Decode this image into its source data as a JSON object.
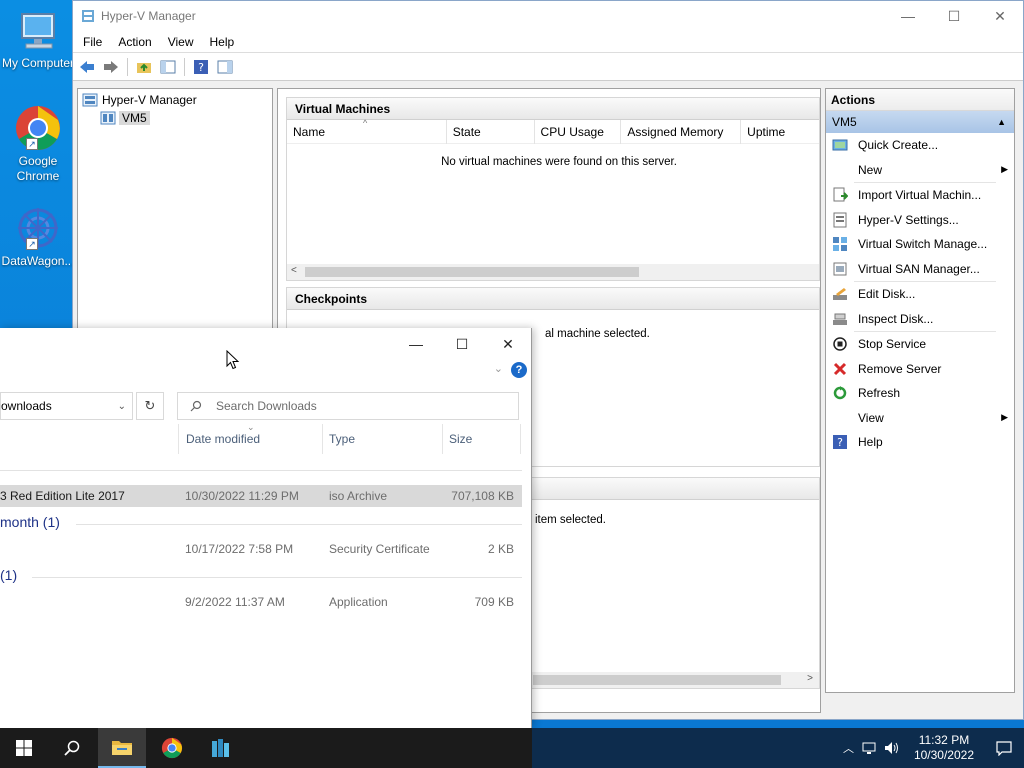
{
  "desktop": {
    "icons": [
      {
        "label": "My Computer",
        "icon": "monitor-icon"
      },
      {
        "label": "Google Chrome",
        "icon": "chrome-icon"
      },
      {
        "label": "DataWagon...",
        "icon": "datawagon-icon"
      }
    ]
  },
  "hyperv": {
    "title": "Hyper-V Manager",
    "menu": [
      "File",
      "Action",
      "View",
      "Help"
    ],
    "tree": {
      "root": "Hyper-V Manager",
      "child": "VM5"
    },
    "vm_pane": {
      "title": "Virtual Machines",
      "columns": [
        "Name",
        "State",
        "CPU Usage",
        "Assigned Memory",
        "Uptime"
      ],
      "empty": "No virtual machines were found on this server."
    },
    "checkpoints": {
      "title": "Checkpoints",
      "empty": "al machine selected."
    },
    "details": {
      "empty": "item selected."
    },
    "actions": {
      "title": "Actions",
      "section": "VM5",
      "items": [
        {
          "label": "Quick Create...",
          "icon": "quick-create-icon",
          "submenu": false
        },
        {
          "label": "New",
          "icon": "",
          "submenu": true
        },
        {
          "label": "Import Virtual Machin...",
          "icon": "import-icon",
          "submenu": false
        },
        {
          "label": "Hyper-V Settings...",
          "icon": "settings-icon",
          "submenu": false
        },
        {
          "label": "Virtual Switch Manage...",
          "icon": "switch-icon",
          "submenu": false
        },
        {
          "label": "Virtual SAN Manager...",
          "icon": "san-icon",
          "submenu": false
        },
        {
          "label": "Edit Disk...",
          "icon": "edit-disk-icon",
          "submenu": false
        },
        {
          "label": "Inspect Disk...",
          "icon": "inspect-disk-icon",
          "submenu": false
        },
        {
          "label": "Stop Service",
          "icon": "stop-icon",
          "submenu": false
        },
        {
          "label": "Remove Server",
          "icon": "remove-icon",
          "submenu": false
        },
        {
          "label": "Refresh",
          "icon": "refresh-icon",
          "submenu": false
        },
        {
          "label": "View",
          "icon": "",
          "submenu": true
        },
        {
          "label": "Help",
          "icon": "help-icon",
          "submenu": false
        }
      ]
    }
  },
  "explorer": {
    "address": "ownloads",
    "search_placeholder": "Search Downloads",
    "columns": [
      "Date modified",
      "Type",
      "Size"
    ],
    "rows": [
      {
        "name": "3 Red Edition Lite 2017",
        "date": "10/30/2022 11:29 PM",
        "type": "iso Archive",
        "size": "707,108 KB"
      },
      {
        "name": "",
        "date": "10/17/2022 7:58 PM",
        "type": "Security Certificate",
        "size": "2 KB"
      },
      {
        "name": "",
        "date": "9/2/2022 11:37 AM",
        "type": "Application",
        "size": "709 KB"
      }
    ],
    "groups": [
      "month (1)",
      "(1)"
    ]
  },
  "taskbar": {
    "time": "11:32 PM",
    "date": "10/30/2022"
  },
  "colors": {
    "accent": "#0078d7",
    "taskbar": "#0d2c4d",
    "selection": "#d9d9d9"
  }
}
